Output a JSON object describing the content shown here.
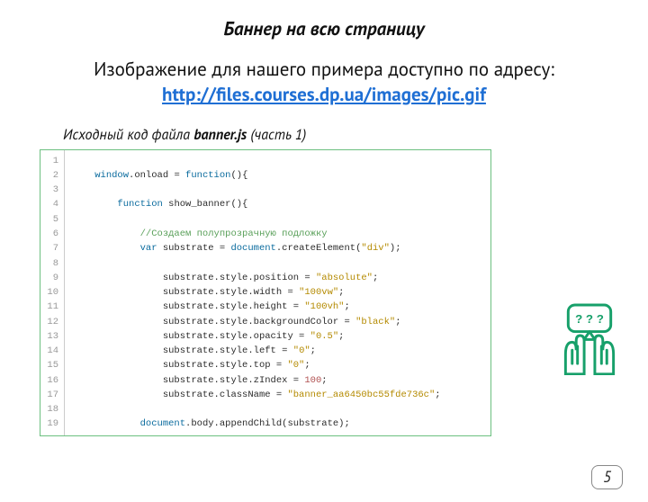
{
  "title": "Баннер на всю страницу",
  "intro_prefix": "Изображение для нашего примера доступно по адресу: ",
  "intro_link": "http://files.courses.dp.ua/images/pic.gif",
  "intro_link_href": "http://files.courses.dp.ua/images/pic.gif",
  "caption_prefix": "Исходный код файла ",
  "caption_filename": "banner.js",
  "caption_suffix": " (часть 1)",
  "gutter_start": 1,
  "gutter_end": 19,
  "code_lines": [
    {
      "indent": 0,
      "tokens": []
    },
    {
      "indent": 1,
      "tokens": [
        {
          "t": "window",
          "c": "kw"
        },
        {
          "t": ".onload = ",
          "c": "prop"
        },
        {
          "t": "function",
          "c": "kw"
        },
        {
          "t": "(){",
          "c": "prop"
        }
      ]
    },
    {
      "indent": 1,
      "tokens": []
    },
    {
      "indent": 2,
      "tokens": [
        {
          "t": "function",
          "c": "kw"
        },
        {
          "t": " show_banner(){",
          "c": "prop"
        }
      ]
    },
    {
      "indent": 2,
      "tokens": []
    },
    {
      "indent": 3,
      "tokens": [
        {
          "t": "//Создаем полупрозрачную подложку",
          "c": "cm"
        }
      ]
    },
    {
      "indent": 3,
      "tokens": [
        {
          "t": "var",
          "c": "kw"
        },
        {
          "t": " substrate = ",
          "c": "prop"
        },
        {
          "t": "document",
          "c": "kw"
        },
        {
          "t": ".createElement(",
          "c": "prop"
        },
        {
          "t": "\"div\"",
          "c": "str"
        },
        {
          "t": ");",
          "c": "prop"
        }
      ]
    },
    {
      "indent": 3,
      "tokens": []
    },
    {
      "indent": 4,
      "tokens": [
        {
          "t": "substrate.style.position = ",
          "c": "prop"
        },
        {
          "t": "\"absolute\"",
          "c": "str"
        },
        {
          "t": ";",
          "c": "prop"
        }
      ]
    },
    {
      "indent": 4,
      "tokens": [
        {
          "t": "substrate.style.width = ",
          "c": "prop"
        },
        {
          "t": "\"100vw\"",
          "c": "str"
        },
        {
          "t": ";",
          "c": "prop"
        }
      ]
    },
    {
      "indent": 4,
      "tokens": [
        {
          "t": "substrate.style.height = ",
          "c": "prop"
        },
        {
          "t": "\"100vh\"",
          "c": "str"
        },
        {
          "t": ";",
          "c": "prop"
        }
      ]
    },
    {
      "indent": 4,
      "tokens": [
        {
          "t": "substrate.style.backgroundColor = ",
          "c": "prop"
        },
        {
          "t": "\"black\"",
          "c": "str"
        },
        {
          "t": ";",
          "c": "prop"
        }
      ]
    },
    {
      "indent": 4,
      "tokens": [
        {
          "t": "substrate.style.opacity = ",
          "c": "prop"
        },
        {
          "t": "\"0.5\"",
          "c": "str"
        },
        {
          "t": ";",
          "c": "prop"
        }
      ]
    },
    {
      "indent": 4,
      "tokens": [
        {
          "t": "substrate.style.left = ",
          "c": "prop"
        },
        {
          "t": "\"0\"",
          "c": "str"
        },
        {
          "t": ";",
          "c": "prop"
        }
      ]
    },
    {
      "indent": 4,
      "tokens": [
        {
          "t": "substrate.style.top = ",
          "c": "prop"
        },
        {
          "t": "\"0\"",
          "c": "str"
        },
        {
          "t": ";",
          "c": "prop"
        }
      ]
    },
    {
      "indent": 4,
      "tokens": [
        {
          "t": "substrate.style.zIndex = ",
          "c": "prop"
        },
        {
          "t": "100",
          "c": "num"
        },
        {
          "t": ";",
          "c": "prop"
        }
      ]
    },
    {
      "indent": 4,
      "tokens": [
        {
          "t": "substrate.className = ",
          "c": "prop"
        },
        {
          "t": "\"banner_aa6450bc55fde736c\"",
          "c": "str"
        },
        {
          "t": ";",
          "c": "prop"
        }
      ]
    },
    {
      "indent": 4,
      "tokens": []
    },
    {
      "indent": 3,
      "tokens": [
        {
          "t": "document",
          "c": "kw"
        },
        {
          "t": ".body.appendChild(substrate);",
          "c": "prop"
        }
      ]
    }
  ],
  "icon_qmarks": "? ? ?",
  "page_number": "5"
}
